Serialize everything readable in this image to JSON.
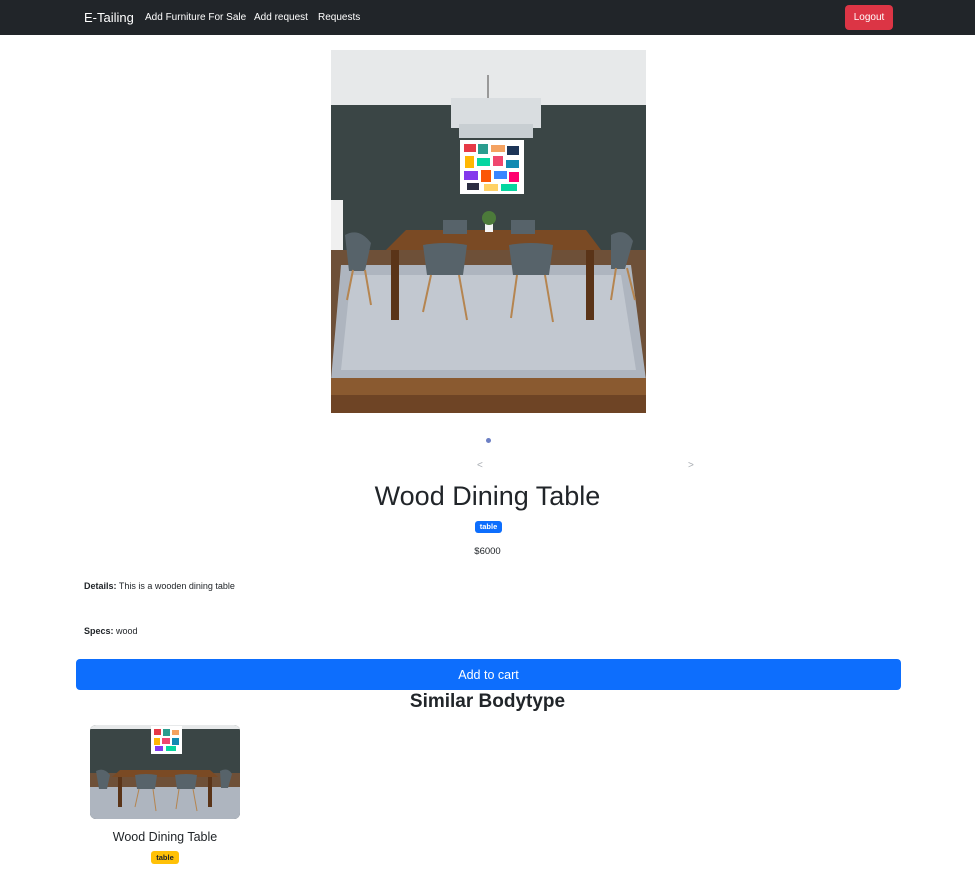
{
  "navbar": {
    "brand": "E-Tailing",
    "links": [
      "Add Furniture For Sale",
      "Add request",
      "Requests"
    ],
    "logout_label": "Logout"
  },
  "carousel": {
    "prev_label": "<",
    "next_label": ">",
    "indicator_count": 1,
    "active_index": 0
  },
  "product": {
    "title": "Wood Dining Table",
    "category_badge": "table",
    "price": "$6000",
    "details_label": "Details:",
    "details_value": "This is a wooden dining table",
    "specs_label": "Specs:",
    "specs_value": "wood",
    "add_to_cart_label": "Add to cart"
  },
  "similar": {
    "heading": "Similar Bodytype",
    "items": [
      {
        "title": "Wood Dining Table",
        "badge": "table"
      }
    ]
  },
  "colors": {
    "navbar_bg": "#212529",
    "primary": "#0d6efd",
    "danger": "#dc3545",
    "warning": "#ffc107"
  }
}
